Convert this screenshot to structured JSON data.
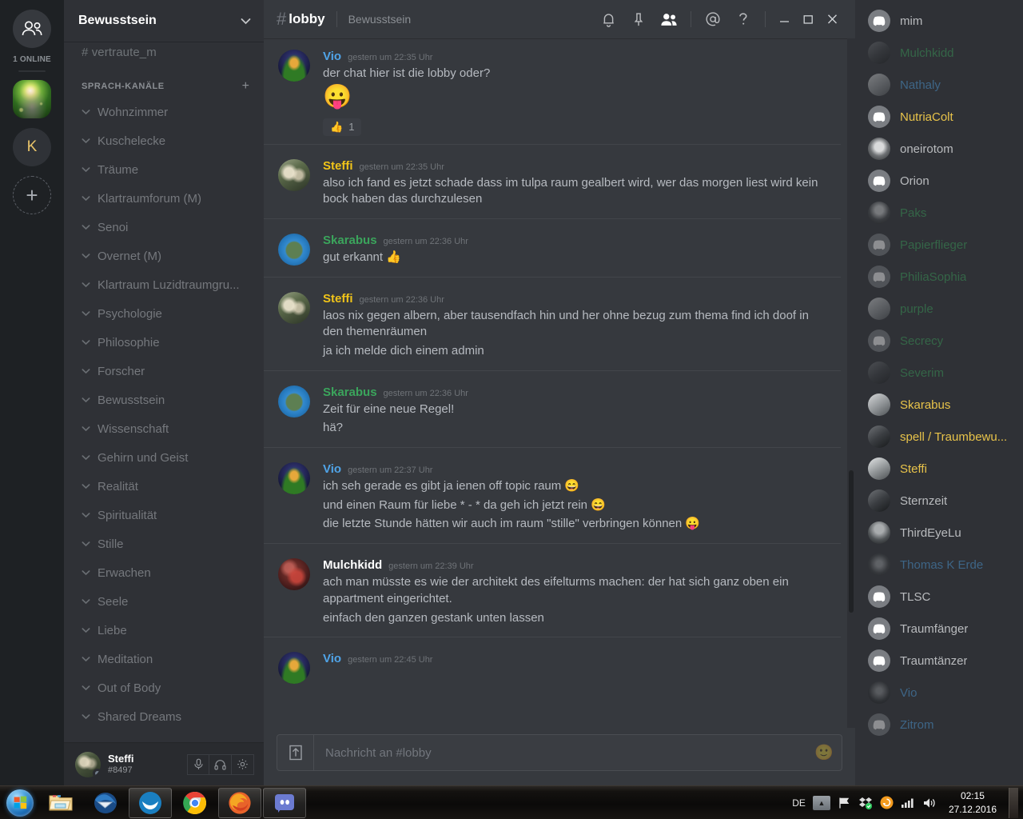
{
  "rail": {
    "dm_icon": "friends-icon",
    "online_label": "1 ONLINE",
    "servers": [
      {
        "name": "Bewusstsein",
        "type": "image",
        "active": true
      },
      {
        "name": "K",
        "type": "letter",
        "letter": "K",
        "active": false
      }
    ],
    "add_label": "+"
  },
  "sidebar": {
    "guild_name": "Bewusstsein",
    "guild_caret": "chevron-down-icon",
    "cut_channel": "# vertraute_m",
    "voice_category": "SPRACH-KANÄLE",
    "add_channel": "+",
    "voice_channels": [
      "Wohnzimmer",
      "Kuschelecke",
      "Träume",
      "Klartraumforum (M)",
      "Senoi",
      "Overnet (M)",
      "Klartraum Luzidtraumgru...",
      "Psychologie",
      "Philosophie",
      "Forscher",
      "Bewusstsein",
      "Wissenschaft",
      "Gehirn und Geist",
      "Realität",
      "Spiritualität",
      "Stille",
      "Erwachen",
      "Seele",
      "Liebe",
      "Meditation",
      "Out of Body",
      "Shared Dreams"
    ]
  },
  "user_panel": {
    "name": "Steffi",
    "tag": "#8497",
    "buttons": [
      "mute-microphone",
      "deafen-headphones",
      "user-settings"
    ]
  },
  "header": {
    "hash": "#",
    "channel": "lobby",
    "topic": "Bewusstsein",
    "icons": [
      "bell-icon",
      "pin-icon",
      "members-icon",
      "mention-icon",
      "help-icon"
    ],
    "window_buttons": [
      "minimize",
      "maximize",
      "close"
    ]
  },
  "messages": [
    {
      "author": "Vio",
      "color": "#50a4e8",
      "timestamp": "gestern um 22:35 Uhr",
      "avatar": "av-vio",
      "lines": [
        "der chat hier ist die lobby oder?"
      ],
      "big_emoji": "😛",
      "reaction": {
        "emoji": "👍",
        "count": "1"
      }
    },
    {
      "author": "Steffi",
      "color": "#f0c419",
      "timestamp": "gestern um 22:35 Uhr",
      "avatar": "av-steffi",
      "lines": [
        "also ich fand es jetzt schade dass im tulpa raum gealbert wird, wer das morgen liest wird kein bock haben das durchzulesen"
      ]
    },
    {
      "author": "Skarabus",
      "color": "#3ba55c",
      "timestamp": "gestern um 22:36 Uhr",
      "avatar": "av-skarabus",
      "lines": [
        "gut erkannt 👍"
      ]
    },
    {
      "author": "Steffi",
      "color": "#f0c419",
      "timestamp": "gestern um 22:36 Uhr",
      "avatar": "av-steffi",
      "lines": [
        "laos nix gegen albern, aber tausendfach hin und her ohne bezug zum thema find ich doof in den themenräumen",
        "ja ich melde dich einem admin"
      ]
    },
    {
      "author": "Skarabus",
      "color": "#3ba55c",
      "timestamp": "gestern um 22:36 Uhr",
      "avatar": "av-skarabus",
      "lines": [
        "Zeit für eine neue Regel!",
        "hä?"
      ]
    },
    {
      "author": "Vio",
      "color": "#50a4e8",
      "timestamp": "gestern um 22:37 Uhr",
      "avatar": "av-vio",
      "lines": [
        "ich seh gerade es gibt ja ienen off topic raum 😄",
        "und einen Raum für liebe * - * da geh ich jetzt rein 😄",
        "die letzte Stunde hätten wir auch im raum \"stille\" verbringen können 😛"
      ]
    },
    {
      "author": "Mulchkidd",
      "color": "#ffffff",
      "timestamp": "gestern um 22:39 Uhr",
      "avatar": "av-mulch",
      "lines": [
        "ach man müsste es wie der architekt des eifelturms machen: der hat sich ganz oben ein appartment eingerichtet.",
        "einfach den ganzen gestank unten lassen"
      ]
    },
    {
      "author": "Vio",
      "color": "#50a4e8",
      "timestamp": "gestern um 22:45 Uhr",
      "avatar": "av-vio",
      "lines": []
    }
  ],
  "composer": {
    "upload_icon": "upload-icon",
    "placeholder": "Nachricht an #lobby",
    "emoji_icon": "emoji-icon"
  },
  "members": [
    {
      "name": "mim",
      "color": "#b9bbbe",
      "dim": false,
      "avatar": "discord-default"
    },
    {
      "name": "Mulchkidd",
      "color": "#3ba55c",
      "dim": true,
      "avatar": "photo-dark"
    },
    {
      "name": "Nathaly",
      "color": "#50a4e8",
      "dim": true,
      "avatar": "photo-light"
    },
    {
      "name": "NutriaColt",
      "color": "#e8c34a",
      "dim": false,
      "avatar": "discord-default"
    },
    {
      "name": "oneirotom",
      "color": "#b9bbbe",
      "dim": false,
      "avatar": "photo-skull"
    },
    {
      "name": "Orion",
      "color": "#b9bbbe",
      "dim": false,
      "avatar": "discord-default"
    },
    {
      "name": "Paks",
      "color": "#3ba55c",
      "dim": true,
      "avatar": "photo-mask"
    },
    {
      "name": "Papierflieger",
      "color": "#3ba55c",
      "dim": true,
      "avatar": "discord-default"
    },
    {
      "name": "PhiliaSophia",
      "color": "#3ba55c",
      "dim": true,
      "avatar": "discord-default"
    },
    {
      "name": "purple",
      "color": "#3ba55c",
      "dim": true,
      "avatar": "photo-light"
    },
    {
      "name": "Secrecy",
      "color": "#3ba55c",
      "dim": true,
      "avatar": "discord-default"
    },
    {
      "name": "Severim",
      "color": "#3ba55c",
      "dim": true,
      "avatar": "photo-dark"
    },
    {
      "name": "Skarabus",
      "color": "#e8c34a",
      "dim": false,
      "avatar": "photo-light"
    },
    {
      "name": "spell / Traumbewu...",
      "color": "#e8c34a",
      "dim": false,
      "avatar": "photo-dark"
    },
    {
      "name": "Steffi",
      "color": "#e8c34a",
      "dim": false,
      "avatar": "photo-steffi"
    },
    {
      "name": "Sternzeit",
      "color": "#b9bbbe",
      "dim": false,
      "avatar": "photo-dark"
    },
    {
      "name": "ThirdEyeLu",
      "color": "#b9bbbe",
      "dim": false,
      "avatar": "photo-person"
    },
    {
      "name": "Thomas K Erde",
      "color": "#50a4e8",
      "dim": true,
      "avatar": "photo-tree"
    },
    {
      "name": "TLSC",
      "color": "#b9bbbe",
      "dim": false,
      "avatar": "discord-default"
    },
    {
      "name": "Traumfänger",
      "color": "#b9bbbe",
      "dim": false,
      "avatar": "discord-default"
    },
    {
      "name": "Traumtänzer",
      "color": "#b9bbbe",
      "dim": false,
      "avatar": "discord-default"
    },
    {
      "name": "Vio",
      "color": "#50a4e8",
      "dim": true,
      "avatar": "photo-vio"
    },
    {
      "name": "Zitrom",
      "color": "#50a4e8",
      "dim": true,
      "avatar": "discord-default"
    }
  ],
  "taskbar": {
    "start": "windows-start-orb",
    "items": [
      {
        "name": "file-explorer",
        "open": false
      },
      {
        "name": "thunderbird",
        "open": false
      },
      {
        "name": "libreoffice",
        "open": true
      },
      {
        "name": "google-chrome",
        "open": false
      },
      {
        "name": "mozilla-firefox",
        "open": true
      },
      {
        "name": "discord",
        "open": true
      }
    ],
    "tray": {
      "language": "DE",
      "icons": [
        "show-hidden-icons",
        "action-center-flag",
        "dropbox-sync",
        "update-orb",
        "network-signal",
        "volume"
      ],
      "time": "02:15",
      "date": "27.12.2016"
    }
  }
}
